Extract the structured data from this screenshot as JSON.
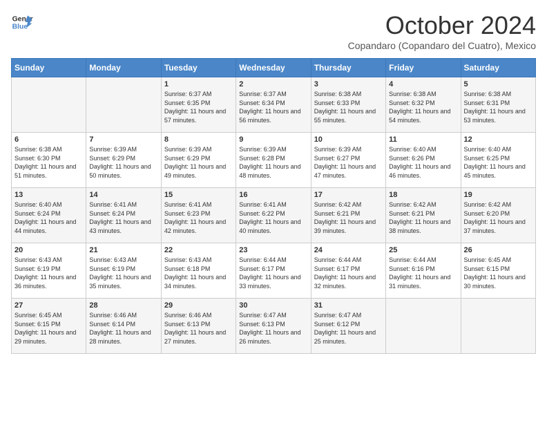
{
  "header": {
    "logo_line1": "General",
    "logo_line2": "Blue",
    "month_title": "October 2024",
    "subtitle": "Copandaro (Copandaro del Cuatro), Mexico"
  },
  "days_of_week": [
    "Sunday",
    "Monday",
    "Tuesday",
    "Wednesday",
    "Thursday",
    "Friday",
    "Saturday"
  ],
  "weeks": [
    [
      {
        "day": "",
        "sunrise": "",
        "sunset": "",
        "daylight": ""
      },
      {
        "day": "",
        "sunrise": "",
        "sunset": "",
        "daylight": ""
      },
      {
        "day": "1",
        "sunrise": "Sunrise: 6:37 AM",
        "sunset": "Sunset: 6:35 PM",
        "daylight": "Daylight: 11 hours and 57 minutes."
      },
      {
        "day": "2",
        "sunrise": "Sunrise: 6:37 AM",
        "sunset": "Sunset: 6:34 PM",
        "daylight": "Daylight: 11 hours and 56 minutes."
      },
      {
        "day": "3",
        "sunrise": "Sunrise: 6:38 AM",
        "sunset": "Sunset: 6:33 PM",
        "daylight": "Daylight: 11 hours and 55 minutes."
      },
      {
        "day": "4",
        "sunrise": "Sunrise: 6:38 AM",
        "sunset": "Sunset: 6:32 PM",
        "daylight": "Daylight: 11 hours and 54 minutes."
      },
      {
        "day": "5",
        "sunrise": "Sunrise: 6:38 AM",
        "sunset": "Sunset: 6:31 PM",
        "daylight": "Daylight: 11 hours and 53 minutes."
      }
    ],
    [
      {
        "day": "6",
        "sunrise": "Sunrise: 6:38 AM",
        "sunset": "Sunset: 6:30 PM",
        "daylight": "Daylight: 11 hours and 51 minutes."
      },
      {
        "day": "7",
        "sunrise": "Sunrise: 6:39 AM",
        "sunset": "Sunset: 6:29 PM",
        "daylight": "Daylight: 11 hours and 50 minutes."
      },
      {
        "day": "8",
        "sunrise": "Sunrise: 6:39 AM",
        "sunset": "Sunset: 6:29 PM",
        "daylight": "Daylight: 11 hours and 49 minutes."
      },
      {
        "day": "9",
        "sunrise": "Sunrise: 6:39 AM",
        "sunset": "Sunset: 6:28 PM",
        "daylight": "Daylight: 11 hours and 48 minutes."
      },
      {
        "day": "10",
        "sunrise": "Sunrise: 6:39 AM",
        "sunset": "Sunset: 6:27 PM",
        "daylight": "Daylight: 11 hours and 47 minutes."
      },
      {
        "day": "11",
        "sunrise": "Sunrise: 6:40 AM",
        "sunset": "Sunset: 6:26 PM",
        "daylight": "Daylight: 11 hours and 46 minutes."
      },
      {
        "day": "12",
        "sunrise": "Sunrise: 6:40 AM",
        "sunset": "Sunset: 6:25 PM",
        "daylight": "Daylight: 11 hours and 45 minutes."
      }
    ],
    [
      {
        "day": "13",
        "sunrise": "Sunrise: 6:40 AM",
        "sunset": "Sunset: 6:24 PM",
        "daylight": "Daylight: 11 hours and 44 minutes."
      },
      {
        "day": "14",
        "sunrise": "Sunrise: 6:41 AM",
        "sunset": "Sunset: 6:24 PM",
        "daylight": "Daylight: 11 hours and 43 minutes."
      },
      {
        "day": "15",
        "sunrise": "Sunrise: 6:41 AM",
        "sunset": "Sunset: 6:23 PM",
        "daylight": "Daylight: 11 hours and 42 minutes."
      },
      {
        "day": "16",
        "sunrise": "Sunrise: 6:41 AM",
        "sunset": "Sunset: 6:22 PM",
        "daylight": "Daylight: 11 hours and 40 minutes."
      },
      {
        "day": "17",
        "sunrise": "Sunrise: 6:42 AM",
        "sunset": "Sunset: 6:21 PM",
        "daylight": "Daylight: 11 hours and 39 minutes."
      },
      {
        "day": "18",
        "sunrise": "Sunrise: 6:42 AM",
        "sunset": "Sunset: 6:21 PM",
        "daylight": "Daylight: 11 hours and 38 minutes."
      },
      {
        "day": "19",
        "sunrise": "Sunrise: 6:42 AM",
        "sunset": "Sunset: 6:20 PM",
        "daylight": "Daylight: 11 hours and 37 minutes."
      }
    ],
    [
      {
        "day": "20",
        "sunrise": "Sunrise: 6:43 AM",
        "sunset": "Sunset: 6:19 PM",
        "daylight": "Daylight: 11 hours and 36 minutes."
      },
      {
        "day": "21",
        "sunrise": "Sunrise: 6:43 AM",
        "sunset": "Sunset: 6:19 PM",
        "daylight": "Daylight: 11 hours and 35 minutes."
      },
      {
        "day": "22",
        "sunrise": "Sunrise: 6:43 AM",
        "sunset": "Sunset: 6:18 PM",
        "daylight": "Daylight: 11 hours and 34 minutes."
      },
      {
        "day": "23",
        "sunrise": "Sunrise: 6:44 AM",
        "sunset": "Sunset: 6:17 PM",
        "daylight": "Daylight: 11 hours and 33 minutes."
      },
      {
        "day": "24",
        "sunrise": "Sunrise: 6:44 AM",
        "sunset": "Sunset: 6:17 PM",
        "daylight": "Daylight: 11 hours and 32 minutes."
      },
      {
        "day": "25",
        "sunrise": "Sunrise: 6:44 AM",
        "sunset": "Sunset: 6:16 PM",
        "daylight": "Daylight: 11 hours and 31 minutes."
      },
      {
        "day": "26",
        "sunrise": "Sunrise: 6:45 AM",
        "sunset": "Sunset: 6:15 PM",
        "daylight": "Daylight: 11 hours and 30 minutes."
      }
    ],
    [
      {
        "day": "27",
        "sunrise": "Sunrise: 6:45 AM",
        "sunset": "Sunset: 6:15 PM",
        "daylight": "Daylight: 11 hours and 29 minutes."
      },
      {
        "day": "28",
        "sunrise": "Sunrise: 6:46 AM",
        "sunset": "Sunset: 6:14 PM",
        "daylight": "Daylight: 11 hours and 28 minutes."
      },
      {
        "day": "29",
        "sunrise": "Sunrise: 6:46 AM",
        "sunset": "Sunset: 6:13 PM",
        "daylight": "Daylight: 11 hours and 27 minutes."
      },
      {
        "day": "30",
        "sunrise": "Sunrise: 6:47 AM",
        "sunset": "Sunset: 6:13 PM",
        "daylight": "Daylight: 11 hours and 26 minutes."
      },
      {
        "day": "31",
        "sunrise": "Sunrise: 6:47 AM",
        "sunset": "Sunset: 6:12 PM",
        "daylight": "Daylight: 11 hours and 25 minutes."
      },
      {
        "day": "",
        "sunrise": "",
        "sunset": "",
        "daylight": ""
      },
      {
        "day": "",
        "sunrise": "",
        "sunset": "",
        "daylight": ""
      }
    ]
  ]
}
